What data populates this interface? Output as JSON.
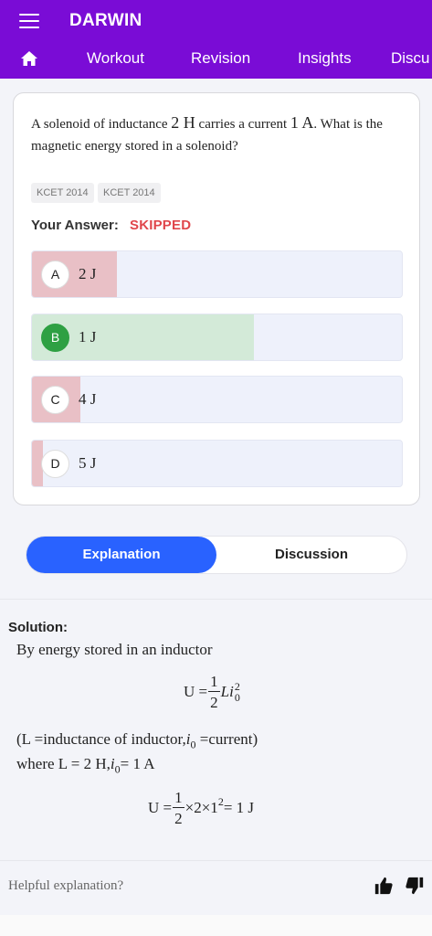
{
  "header": {
    "app_title": "DARWIN",
    "menu_icon": "hamburger-icon",
    "nav_items": [
      "Workout",
      "Revision",
      "Insights",
      "Discu"
    ],
    "home_icon": "home-icon",
    "bg_color": "#7a0cd6"
  },
  "question": {
    "text_part1": "A solenoid of inductance ",
    "val1": "2 H",
    "text_part2": " carries a current ",
    "val2": "1 A",
    "text_part3": ". What is the magnetic energy stored in a solenoid?",
    "tags": [
      "KCET 2014",
      "KCET 2014"
    ],
    "your_answer_label": "Your Answer:",
    "your_answer_value": "SKIPPED"
  },
  "options": [
    {
      "letter": "A",
      "text": "2 J",
      "fill_percent": 23,
      "fill_color": "#e9c0c6",
      "correct": false
    },
    {
      "letter": "B",
      "text": "1 J",
      "fill_percent": 60,
      "fill_color": "#d3ead8",
      "correct": true
    },
    {
      "letter": "C",
      "text": "4 J",
      "fill_percent": 13,
      "fill_color": "#e9c0c6",
      "correct": false
    },
    {
      "letter": "D",
      "text": "5 J",
      "fill_percent": 3,
      "fill_color": "#e9c0c6",
      "correct": false
    }
  ],
  "tabs": {
    "explanation": "Explanation",
    "discussion": "Discussion"
  },
  "solution": {
    "label": "Solution:",
    "line1": "By energy stored in an inductor",
    "eq1_lhs": "U =",
    "eq1_num": "1",
    "eq1_den": "2",
    "eq1_rhs_L": "L",
    "eq1_rhs_i": "i",
    "eq1_sub": "0",
    "eq1_sup": "2",
    "line3_a": "(L =inductance of inductor,",
    "line3_i": "i",
    "line3_sub": "0",
    "line3_b": " =current)",
    "line4_a": "where L = 2 H,",
    "line4_i": "i",
    "line4_sub": "0",
    "line4_b": "= 1 A",
    "eq2_lhs": "U =",
    "eq2_num": "1",
    "eq2_den": "2",
    "eq2_rhs_a": "×2×1",
    "eq2_sup": "2",
    "eq2_rhs_b": "= 1 J"
  },
  "feedback": {
    "label": "Helpful explanation?",
    "like_icon": "thumbs-up-icon",
    "dislike_icon": "thumbs-down-icon"
  }
}
